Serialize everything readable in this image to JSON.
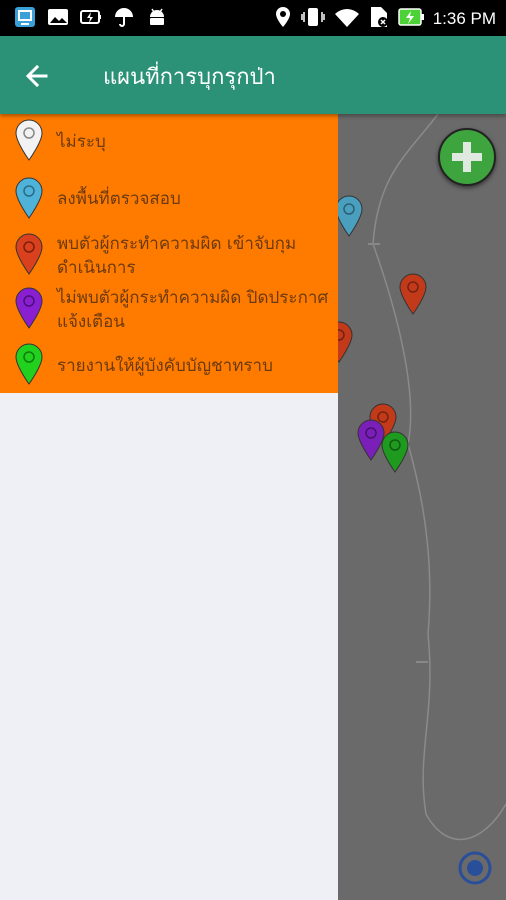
{
  "status_bar": {
    "time": "1:36 PM",
    "left_icons": [
      "screencast-icon",
      "image-icon",
      "battery-charging-icon",
      "umbrella-icon",
      "android-icon"
    ],
    "right_icons": [
      "location-icon",
      "vibrate-icon",
      "wifi-icon",
      "sim-icon",
      "battery-icon"
    ]
  },
  "app_bar": {
    "title": "แผนที่การบุกรุกป่า",
    "back_icon": "arrow-left-icon",
    "color": "#2b9278"
  },
  "legend": {
    "background": "#ff7b00",
    "items": [
      {
        "label": "ไม่ระบุ",
        "color": "#f2f2f2"
      },
      {
        "label": "ลงพื้นที่ตรวจสอบ",
        "color": "#4fb3d9"
      },
      {
        "label": "พบตัวผู้กระทำความผิด เข้าจับกุมดำเนินการ",
        "color": "#d9411e"
      },
      {
        "label": "ไม่พบตัวผู้กระทำความผิด ปิดประกาศแจ้งเตือน",
        "color": "#8a1fd1"
      },
      {
        "label": "รายงานให้ผู้บังคับบัญชาทราบ",
        "color": "#22d11e"
      }
    ]
  },
  "map": {
    "add_button_icon": "plus-icon",
    "location_button_icon": "my-location-icon",
    "markers": [
      {
        "status": "ลงพื้นที่ตรวจสอบ",
        "color": "#4a9fbf"
      },
      {
        "status": "พบตัวผู้กระทำความผิด เข้าจับกุมดำเนินการ",
        "color": "#c23a1a"
      },
      {
        "status": "พบตัวผู้กระทำความผิด เข้าจับกุมดำเนินการ",
        "color": "#c23a1a"
      },
      {
        "status": "พบตัวผู้กระทำความผิด เข้าจับกุมดำเนินการ",
        "color": "#c23a1a"
      },
      {
        "status": "ไม่พบตัวผู้กระทำความผิด ปิดประกาศแจ้งเตือน",
        "color": "#7a1fb8"
      },
      {
        "status": "รายงานให้ผู้บังคับบัญชาทราบ",
        "color": "#1e9a1e"
      }
    ]
  }
}
